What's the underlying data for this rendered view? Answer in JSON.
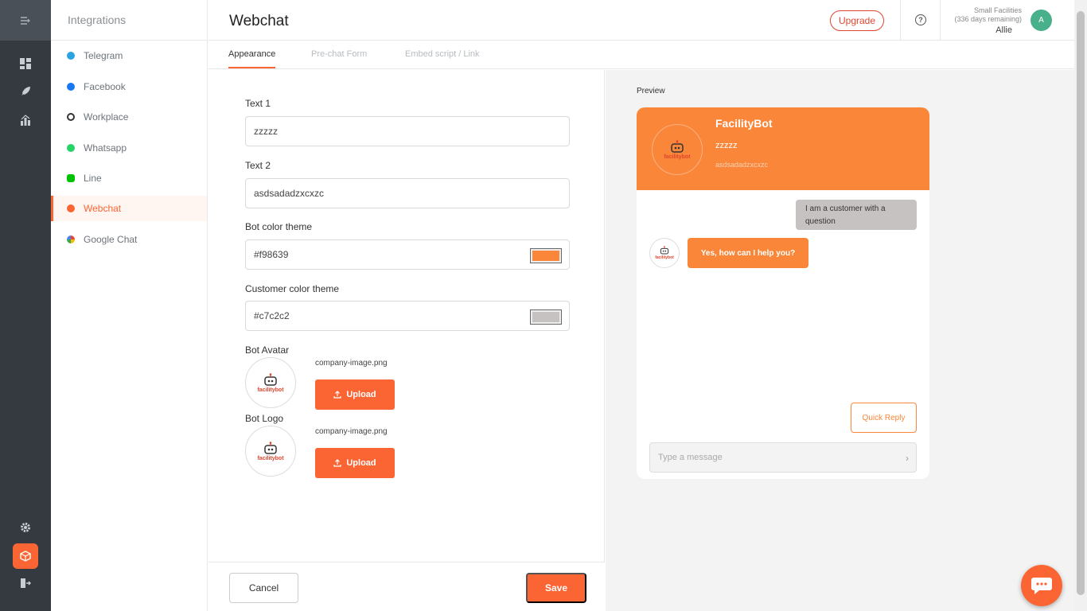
{
  "sidebar": {
    "title": "Integrations",
    "items": [
      {
        "label": "Telegram",
        "icon": "telegram-icon",
        "color": "#2aa3e0"
      },
      {
        "label": "Facebook",
        "icon": "facebook-icon",
        "color": "#1877f2"
      },
      {
        "label": "Workplace",
        "icon": "workplace-icon",
        "color": "#333333"
      },
      {
        "label": "Whatsapp",
        "icon": "whatsapp-icon",
        "color": "#25d366"
      },
      {
        "label": "Line",
        "icon": "line-icon",
        "color": "#00c300"
      },
      {
        "label": "Webchat",
        "icon": "webchat-icon",
        "color": "#fb6534"
      },
      {
        "label": "Google Chat",
        "icon": "google-chat-icon",
        "color": "#34a853"
      }
    ]
  },
  "header": {
    "title": "Webchat",
    "upgrade_label": "Upgrade",
    "plan_line1": "Small Facilities",
    "plan_line2": "(336 days remaining)",
    "user_name": "Allie",
    "avatar_initial": "A"
  },
  "tabs": [
    {
      "label": "Appearance"
    },
    {
      "label": "Pre-chat Form"
    },
    {
      "label": "Embed script / Link"
    }
  ],
  "form": {
    "text1_label": "Text 1",
    "text1_value": "zzzzz",
    "text2_label": "Text 2",
    "text2_value": "asdsadadzxcxzc",
    "bot_color_label": "Bot color theme",
    "bot_color_value": "#f98639",
    "customer_color_label": "Customer color theme",
    "customer_color_value": "#c7c2c2",
    "bot_avatar_label": "Bot Avatar",
    "bot_avatar_file": "company-image.png",
    "bot_logo_label": "Bot Logo",
    "bot_logo_file": "company-image.png",
    "upload_label": "Upload",
    "cancel_label": "Cancel",
    "save_label": "Save",
    "logo_text": "facilitybot"
  },
  "preview": {
    "label": "Preview",
    "bot_name": "FacilityBot",
    "text1": "zzzzz",
    "text2": "asdsadadzxcxzc",
    "customer_message": "I am a customer with a question",
    "bot_message": "Yes, how can I help you?",
    "quick_reply_label": "Quick Reply",
    "input_placeholder": "Type a message"
  },
  "colors": {
    "accent": "#fb6534",
    "bot_theme": "#f98639",
    "customer_theme": "#c7c2c2",
    "rail": "#343a40"
  }
}
